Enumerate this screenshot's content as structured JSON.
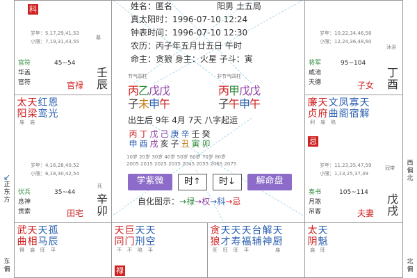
{
  "tl": {
    "tag": "科"
  },
  "palace_tl2": {
    "years": "岁年：5,17,29,41,53",
    "minor": "小限：7,19,31,43,55",
    "sm1": [
      "官",
      "符"
    ],
    "sm2": [
      "华",
      "盖"
    ],
    "sm3": [
      "官",
      "符"
    ],
    "range": "45~54",
    "god": "官禄",
    "state": "墓",
    "stem": [
      "壬",
      "辰"
    ]
  },
  "palace_tr1": {
    "years": "岁年：10,22,34,46,58",
    "minor": "小限：12,24,36,48,60",
    "sm1": [
      "将",
      "军"
    ],
    "sm2": [
      "咸",
      "池"
    ],
    "sm3": [
      "天",
      "德"
    ],
    "range": "95~104",
    "god": "子女",
    "state": "沐浴",
    "stem": [
      "丁",
      "酉"
    ]
  },
  "palace_l": {
    "years": "岁年：4,16,28,40,52",
    "minor": "小限：6,18,30,42,54",
    "sm1": [
      "伏",
      "兵"
    ],
    "sm2": [
      "息",
      "神"
    ],
    "sm3": [
      "贯",
      "索"
    ],
    "range": "35~44",
    "god": "田宅",
    "state": "死",
    "stem": [
      "辛",
      "卯"
    ]
  },
  "palace_r": {
    "years": "岁年：11,23,35,47,59",
    "minor": "小限：1,13,25,37,49",
    "sm1": [
      "奏",
      "书"
    ],
    "sm2": [
      "月",
      "煞"
    ],
    "sm3": [
      "吊",
      "客"
    ],
    "range": "105~114",
    "god": "夫妻",
    "state": "冠带",
    "stem": [
      "戊",
      "戌"
    ]
  },
  "stars_l": [
    {
      "n": [
        "太",
        "阳"
      ],
      "b": "庙",
      "c": "red"
    },
    {
      "n": [
        "天",
        "梁"
      ],
      "b": "庙",
      "c": "red"
    },
    {
      "n": [
        "红",
        "鸾"
      ],
      "b": "",
      "c": "blue"
    },
    {
      "n": [
        "恩",
        "光"
      ],
      "b": "",
      "c": "blue"
    }
  ],
  "stars_r": [
    {
      "n": [
        "廉",
        "贞"
      ],
      "b": "利",
      "c": "red"
    },
    {
      "n": [
        "天",
        "府"
      ],
      "b": "庙",
      "c": "red"
    },
    {
      "n": [
        "文",
        "曲"
      ],
      "b": "陷",
      "c": "blue"
    },
    {
      "n": [
        "凤",
        "阁"
      ],
      "b": "",
      "c": "blue"
    },
    {
      "n": [
        "寡",
        "宿"
      ],
      "b": "",
      "c": "blue"
    },
    {
      "n": [
        "天",
        "解"
      ],
      "b": "",
      "c": "blue"
    }
  ],
  "r_tag": "忌",
  "stars_b1": [
    {
      "n": [
        "武",
        "曲"
      ],
      "b": "得",
      "c": "red"
    },
    {
      "n": [
        "天",
        "相"
      ],
      "b": "庙",
      "c": "red"
    },
    {
      "n": [
        "天",
        "马"
      ],
      "b": "旺",
      "c": "blue"
    },
    {
      "n": [
        "孤",
        "辰"
      ],
      "b": "平",
      "c": "blue"
    }
  ],
  "stars_b2": [
    {
      "n": [
        "天",
        "同"
      ],
      "b": "不",
      "c": "red"
    },
    {
      "n": [
        "巨",
        "门"
      ],
      "b": "不",
      "c": "red"
    },
    {
      "n": [
        "天",
        "刑"
      ],
      "b": "陷",
      "c": "blue"
    },
    {
      "n": [
        "天",
        "空"
      ],
      "b": "平",
      "c": "blue"
    }
  ],
  "b2_tag": "禄",
  "stars_b3": [
    {
      "n": [
        "贪",
        "狼"
      ],
      "b": "旺",
      "c": "red"
    },
    {
      "n": [
        "天",
        "才"
      ],
      "b": "旺",
      "c": "blue"
    },
    {
      "n": [
        "天",
        "寿"
      ],
      "b": "旺",
      "c": "blue"
    },
    {
      "n": [
        "天",
        "福"
      ],
      "b": "平",
      "c": "blue"
    },
    {
      "n": [
        "台",
        "辅"
      ],
      "b": "",
      "c": "blue"
    },
    {
      "n": [
        "解",
        "神"
      ],
      "b": "",
      "c": "blue"
    },
    {
      "n": [
        "天",
        "厨"
      ],
      "b": "庙",
      "c": "blue"
    }
  ],
  "stars_b4": [
    {
      "n": [
        "太",
        "阴"
      ],
      "b": "庙",
      "c": "red"
    },
    {
      "n": [
        "天",
        "魁"
      ],
      "b": "旺",
      "c": "blue"
    }
  ],
  "center": {
    "name": "姓名：匿名",
    "gender": "阳男 土五局",
    "solar": "真太阳时：1996-07-10 12:24",
    "clock": "钟表时间：1996-07-10 12:30",
    "lunar": "农历：丙子年五月廿五日 午时",
    "ming": "命主：贪狼 身主：火星 子斗：寅",
    "jieqi_label": "节气四柱",
    "feijie_label": "非节气四柱",
    "pillars1_top": [
      "丙",
      "乙",
      "戊",
      "戊"
    ],
    "pillars1_bot": [
      "子",
      "未",
      "申",
      "午"
    ],
    "pillars2_top": [
      "丙",
      "甲",
      "戊",
      "戊"
    ],
    "pillars2_bot": [
      "子",
      "午",
      "申",
      "午"
    ],
    "qiyun": "出生后 9年 4月 7天 八字起运",
    "dayun_top": [
      "丙",
      "丁",
      "戊",
      "己",
      "庚",
      "辛",
      "壬",
      "癸"
    ],
    "dayun_bot": [
      "申",
      "酉",
      "戌",
      "亥",
      "子",
      "丑",
      "寅",
      "卯"
    ],
    "ages": [
      "10岁",
      "20岁",
      "30岁",
      "40岁",
      "50岁",
      "60岁",
      "70岁",
      "80岁"
    ],
    "years": [
      "2005",
      "2015",
      "2025",
      "2035",
      "2045",
      "2055",
      "2065",
      "2075"
    ],
    "btn_xue": "学紫微",
    "btn_up": "时↑",
    "btn_down": "时↓",
    "btn_jie": "解命盘",
    "legend_label": "自化图示：",
    "legend_lu": "→禄",
    "legend_quan": "→权",
    "legend_ke": "→科",
    "legend_ji": "→忌"
  },
  "edge": {
    "left_mid": [
      "正",
      "东",
      "方"
    ],
    "left_bot": [
      "东",
      "偏"
    ],
    "right_mid": [
      "西",
      "偏",
      "北"
    ],
    "right_bot": [
      "北",
      "偏"
    ]
  }
}
